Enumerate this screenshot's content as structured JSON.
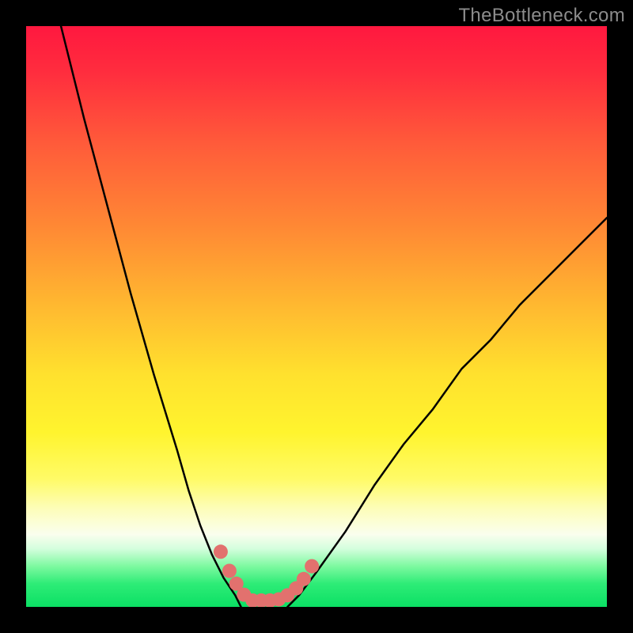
{
  "watermark": "TheBottleneck.com",
  "chart_data": {
    "type": "line",
    "title": "",
    "xlabel": "",
    "ylabel": "",
    "xlim": [
      0,
      100
    ],
    "ylim": [
      0,
      100
    ],
    "grid": false,
    "series": [
      {
        "name": "curve-left",
        "x": [
          6,
          10,
          14,
          18,
          22,
          26,
          28,
          30,
          32,
          34,
          36,
          37
        ],
        "y": [
          100,
          84,
          69,
          54,
          40,
          27,
          20,
          14,
          9,
          5,
          2,
          0
        ]
      },
      {
        "name": "curve-right",
        "x": [
          45,
          47,
          50,
          55,
          60,
          65,
          70,
          75,
          80,
          85,
          90,
          95,
          100
        ],
        "y": [
          0,
          2,
          6,
          13,
          21,
          28,
          34,
          41,
          46,
          52,
          57,
          62,
          67
        ]
      },
      {
        "name": "marker-band",
        "color": "#e2716e",
        "points": [
          {
            "x": 33.5,
            "y": 9.5
          },
          {
            "x": 35.0,
            "y": 6.2
          },
          {
            "x": 36.2,
            "y": 4.0
          },
          {
            "x": 37.5,
            "y": 2.1
          },
          {
            "x": 39.0,
            "y": 1.1
          },
          {
            "x": 40.5,
            "y": 1.1
          },
          {
            "x": 42.0,
            "y": 1.1
          },
          {
            "x": 43.5,
            "y": 1.3
          },
          {
            "x": 45.0,
            "y": 2.0
          },
          {
            "x": 46.5,
            "y": 3.2
          },
          {
            "x": 47.8,
            "y": 4.8
          },
          {
            "x": 49.2,
            "y": 7.0
          }
        ]
      }
    ]
  }
}
